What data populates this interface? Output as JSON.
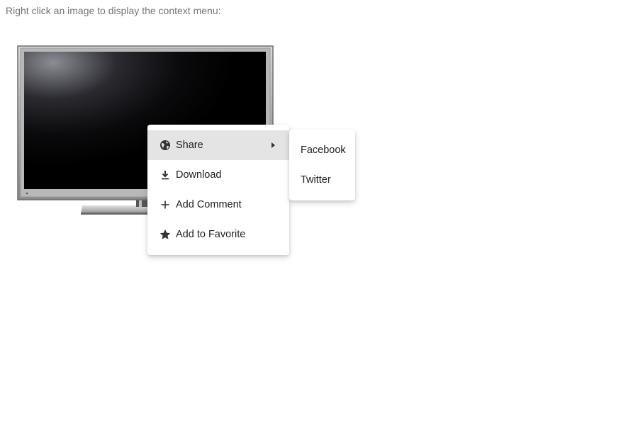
{
  "instruction": "Right click an image to display the context menu:",
  "image": {
    "subject": "television"
  },
  "context_menu": {
    "items": [
      {
        "label": "Share",
        "icon": "globe-icon",
        "has_submenu": true,
        "active": true
      },
      {
        "label": "Download",
        "icon": "download-icon"
      },
      {
        "label": "Add Comment",
        "icon": "plus-icon"
      },
      {
        "label": "Add to Favorite",
        "icon": "star-icon"
      }
    ]
  },
  "share_submenu": {
    "items": [
      {
        "label": "Facebook"
      },
      {
        "label": "Twitter"
      }
    ]
  },
  "colors": {
    "active_item_bg": "#e4e4e4",
    "text": "#212121",
    "instruction_text": "#757575"
  }
}
